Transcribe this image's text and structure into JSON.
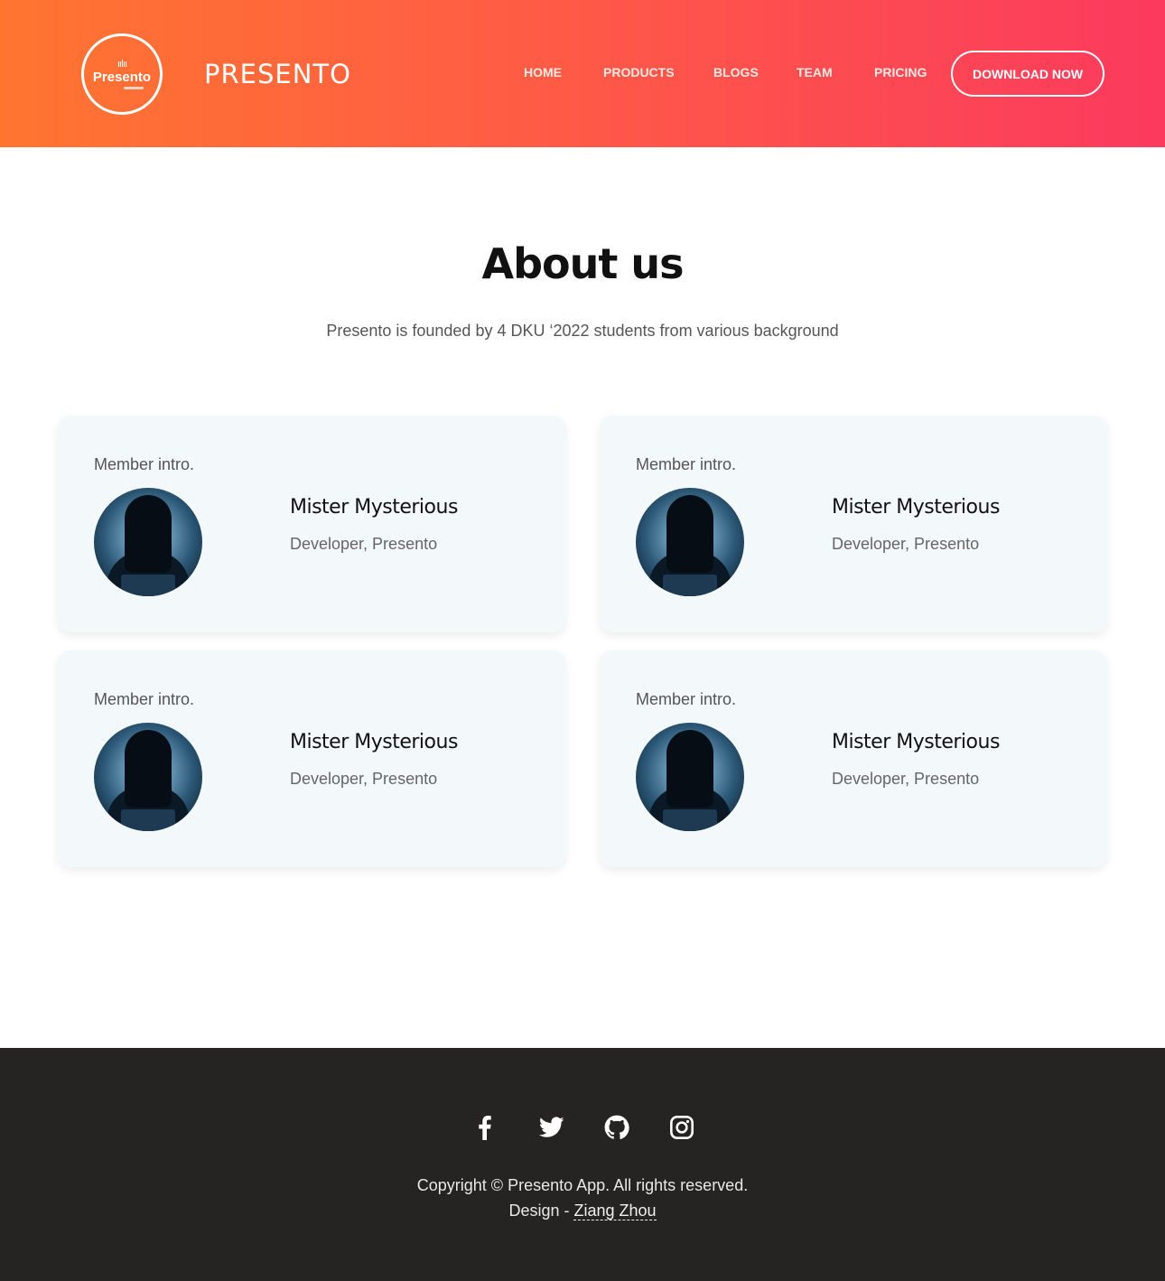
{
  "header": {
    "logo_text": "Presento",
    "brand": "PRESENTO",
    "nav": [
      "HOME",
      "PRODUCTS",
      "BLOGS",
      "TEAM",
      "PRICING"
    ],
    "cta_label": "DOWNLOAD NOW",
    "gradient": [
      "#ff7530",
      "#fb3a5e"
    ]
  },
  "about": {
    "title": "About us",
    "subtitle": "Presento is founded by 4 DKU ‘2022 students from various background"
  },
  "members": [
    {
      "intro": "Member intro.",
      "name": "Mister Mysterious",
      "role": "Developer, Presento"
    },
    {
      "intro": "Member intro.",
      "name": "Mister Mysterious",
      "role": "Developer, Presento"
    },
    {
      "intro": "Member intro.",
      "name": "Mister Mysterious",
      "role": "Developer, Presento"
    },
    {
      "intro": "Member intro.",
      "name": "Mister Mysterious",
      "role": "Developer, Presento"
    }
  ],
  "footer": {
    "social": [
      "facebook-icon",
      "twitter-icon",
      "github-icon",
      "instagram-icon"
    ],
    "copyright": "Copyright © Presento App. All rights reserved.",
    "design_prefix": "Design - ",
    "designer": "Ziang Zhou",
    "background": "#252423"
  }
}
